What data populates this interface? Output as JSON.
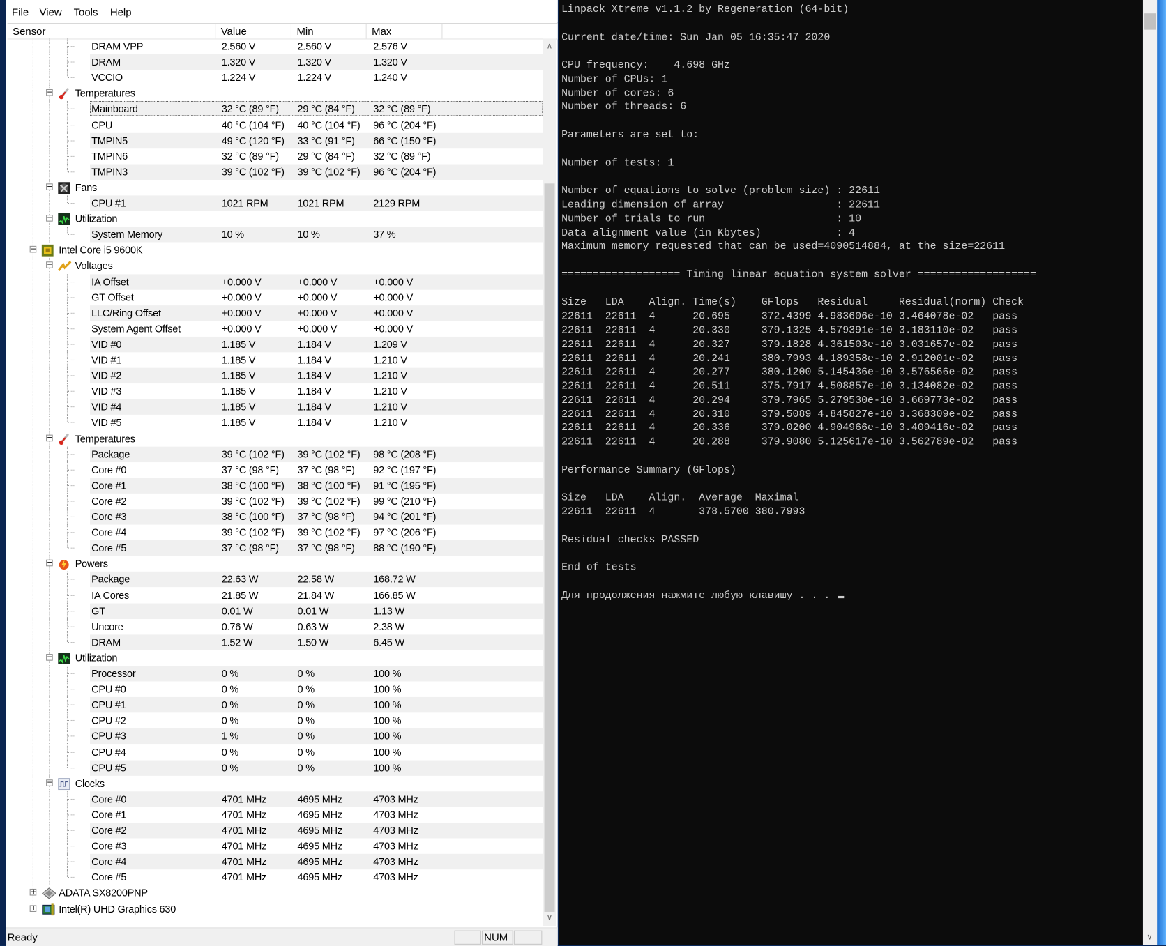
{
  "menu": [
    "File",
    "View",
    "Tools",
    "Help"
  ],
  "columns": {
    "sensor": "Sensor",
    "value": "Value",
    "min": "Min",
    "max": "Max"
  },
  "rows": [
    {
      "type": "leaf",
      "label": "DRAM VPP",
      "value": "2.560 V",
      "min": "2.560 V",
      "max": "2.576 V"
    },
    {
      "type": "leaf",
      "label": "DRAM",
      "value": "1.320 V",
      "min": "1.320 V",
      "max": "1.320 V"
    },
    {
      "type": "leaf",
      "label": "VCCIO",
      "value": "1.224 V",
      "min": "1.224 V",
      "max": "1.240 V"
    },
    {
      "type": "group",
      "level": 1,
      "icon": "thermometer-icon",
      "label": "Temperatures"
    },
    {
      "type": "leaf",
      "label": "Mainboard",
      "value": "32 °C  (89 °F)",
      "min": "29 °C  (84 °F)",
      "max": "32 °C  (89 °F)",
      "selected": true
    },
    {
      "type": "leaf",
      "label": "CPU",
      "value": "40 °C  (104 °F)",
      "min": "40 °C  (104 °F)",
      "max": "96 °C  (204 °F)"
    },
    {
      "type": "leaf",
      "label": "TMPIN5",
      "value": "49 °C  (120 °F)",
      "min": "33 °C  (91 °F)",
      "max": "66 °C  (150 °F)"
    },
    {
      "type": "leaf",
      "label": "TMPIN6",
      "value": "32 °C  (89 °F)",
      "min": "29 °C  (84 °F)",
      "max": "32 °C  (89 °F)"
    },
    {
      "type": "leaf",
      "label": "TMPIN3",
      "value": "39 °C  (102 °F)",
      "min": "39 °C  (102 °F)",
      "max": "96 °C  (204 °F)"
    },
    {
      "type": "group",
      "level": 1,
      "icon": "fan-icon",
      "label": "Fans"
    },
    {
      "type": "leaf",
      "label": "CPU #1",
      "value": "1021 RPM",
      "min": "1021 RPM",
      "max": "2129 RPM"
    },
    {
      "type": "group",
      "level": 1,
      "icon": "utilization-icon",
      "label": "Utilization"
    },
    {
      "type": "leaf",
      "label": "System Memory",
      "value": "10 %",
      "min": "10 %",
      "max": "37 %"
    },
    {
      "type": "group",
      "level": 0,
      "icon": "cpu-chip-icon",
      "label": "Intel Core i5 9600K",
      "expanded": true
    },
    {
      "type": "group",
      "level": 1,
      "icon": "voltage-icon",
      "label": "Voltages"
    },
    {
      "type": "leaf",
      "label": "IA Offset",
      "value": "+0.000 V",
      "min": "+0.000 V",
      "max": "+0.000 V"
    },
    {
      "type": "leaf",
      "label": "GT Offset",
      "value": "+0.000 V",
      "min": "+0.000 V",
      "max": "+0.000 V"
    },
    {
      "type": "leaf",
      "label": "LLC/Ring Offset",
      "value": "+0.000 V",
      "min": "+0.000 V",
      "max": "+0.000 V"
    },
    {
      "type": "leaf",
      "label": "System Agent Offset",
      "value": "+0.000 V",
      "min": "+0.000 V",
      "max": "+0.000 V"
    },
    {
      "type": "leaf",
      "label": "VID #0",
      "value": "1.185 V",
      "min": "1.184 V",
      "max": "1.209 V"
    },
    {
      "type": "leaf",
      "label": "VID #1",
      "value": "1.185 V",
      "min": "1.184 V",
      "max": "1.210 V"
    },
    {
      "type": "leaf",
      "label": "VID #2",
      "value": "1.185 V",
      "min": "1.184 V",
      "max": "1.210 V"
    },
    {
      "type": "leaf",
      "label": "VID #3",
      "value": "1.185 V",
      "min": "1.184 V",
      "max": "1.210 V"
    },
    {
      "type": "leaf",
      "label": "VID #4",
      "value": "1.185 V",
      "min": "1.184 V",
      "max": "1.210 V"
    },
    {
      "type": "leaf",
      "label": "VID #5",
      "value": "1.185 V",
      "min": "1.184 V",
      "max": "1.210 V"
    },
    {
      "type": "group",
      "level": 1,
      "icon": "thermometer-icon",
      "label": "Temperatures"
    },
    {
      "type": "leaf",
      "label": "Package",
      "value": "39 °C  (102 °F)",
      "min": "39 °C  (102 °F)",
      "max": "98 °C  (208 °F)"
    },
    {
      "type": "leaf",
      "label": "Core #0",
      "value": "37 °C  (98 °F)",
      "min": "37 °C  (98 °F)",
      "max": "92 °C  (197 °F)"
    },
    {
      "type": "leaf",
      "label": "Core #1",
      "value": "38 °C  (100 °F)",
      "min": "38 °C  (100 °F)",
      "max": "91 °C  (195 °F)"
    },
    {
      "type": "leaf",
      "label": "Core #2",
      "value": "39 °C  (102 °F)",
      "min": "39 °C  (102 °F)",
      "max": "99 °C  (210 °F)"
    },
    {
      "type": "leaf",
      "label": "Core #3",
      "value": "38 °C  (100 °F)",
      "min": "37 °C  (98 °F)",
      "max": "94 °C  (201 °F)"
    },
    {
      "type": "leaf",
      "label": "Core #4",
      "value": "39 °C  (102 °F)",
      "min": "39 °C  (102 °F)",
      "max": "97 °C  (206 °F)"
    },
    {
      "type": "leaf",
      "label": "Core #5",
      "value": "37 °C  (98 °F)",
      "min": "37 °C  (98 °F)",
      "max": "88 °C  (190 °F)"
    },
    {
      "type": "group",
      "level": 1,
      "icon": "power-icon",
      "label": "Powers"
    },
    {
      "type": "leaf",
      "label": "Package",
      "value": "22.63 W",
      "min": "22.58 W",
      "max": "168.72 W"
    },
    {
      "type": "leaf",
      "label": "IA Cores",
      "value": "21.85 W",
      "min": "21.84 W",
      "max": "166.85 W"
    },
    {
      "type": "leaf",
      "label": "GT",
      "value": "0.01 W",
      "min": "0.01 W",
      "max": "1.13 W"
    },
    {
      "type": "leaf",
      "label": "Uncore",
      "value": "0.76 W",
      "min": "0.63 W",
      "max": "2.38 W"
    },
    {
      "type": "leaf",
      "label": "DRAM",
      "value": "1.52 W",
      "min": "1.50 W",
      "max": "6.45 W"
    },
    {
      "type": "group",
      "level": 1,
      "icon": "utilization-icon",
      "label": "Utilization"
    },
    {
      "type": "leaf",
      "label": "Processor",
      "value": "0 %",
      "min": "0 %",
      "max": "100 %"
    },
    {
      "type": "leaf",
      "label": "CPU #0",
      "value": "0 %",
      "min": "0 %",
      "max": "100 %"
    },
    {
      "type": "leaf",
      "label": "CPU #1",
      "value": "0 %",
      "min": "0 %",
      "max": "100 %"
    },
    {
      "type": "leaf",
      "label": "CPU #2",
      "value": "0 %",
      "min": "0 %",
      "max": "100 %"
    },
    {
      "type": "leaf",
      "label": "CPU #3",
      "value": "1 %",
      "min": "0 %",
      "max": "100 %"
    },
    {
      "type": "leaf",
      "label": "CPU #4",
      "value": "0 %",
      "min": "0 %",
      "max": "100 %"
    },
    {
      "type": "leaf",
      "label": "CPU #5",
      "value": "0 %",
      "min": "0 %",
      "max": "100 %"
    },
    {
      "type": "group",
      "level": 1,
      "icon": "clock-icon",
      "label": "Clocks"
    },
    {
      "type": "leaf",
      "label": "Core #0",
      "value": "4701 MHz",
      "min": "4695 MHz",
      "max": "4703 MHz"
    },
    {
      "type": "leaf",
      "label": "Core #1",
      "value": "4701 MHz",
      "min": "4695 MHz",
      "max": "4703 MHz"
    },
    {
      "type": "leaf",
      "label": "Core #2",
      "value": "4701 MHz",
      "min": "4695 MHz",
      "max": "4703 MHz"
    },
    {
      "type": "leaf",
      "label": "Core #3",
      "value": "4701 MHz",
      "min": "4695 MHz",
      "max": "4703 MHz"
    },
    {
      "type": "leaf",
      "label": "Core #4",
      "value": "4701 MHz",
      "min": "4695 MHz",
      "max": "4703 MHz"
    },
    {
      "type": "leaf",
      "label": "Core #5",
      "value": "4701 MHz",
      "min": "4695 MHz",
      "max": "4703 MHz"
    },
    {
      "type": "group",
      "level": 0,
      "icon": "ssd-icon",
      "label": "ADATA SX8200PNP",
      "expanded": false
    },
    {
      "type": "group",
      "level": 0,
      "icon": "gpu-icon",
      "label": "Intel(R) UHD Graphics 630",
      "expanded": false
    }
  ],
  "status": {
    "text": "Ready",
    "num": "NUM"
  },
  "console": {
    "lines": [
      "Linpack Xtreme v1.1.2 by Regeneration (64-bit)",
      "",
      "Current date/time: Sun Jan 05 16:35:47 2020",
      "",
      "CPU frequency:    4.698 GHz",
      "Number of CPUs: 1",
      "Number of cores: 6",
      "Number of threads: 6",
      "",
      "Parameters are set to:",
      "",
      "Number of tests: 1",
      "",
      "Number of equations to solve (problem size) : 22611",
      "Leading dimension of array                  : 22611",
      "Number of trials to run                     : 10",
      "Data alignment value (in Kbytes)            : 4",
      "Maximum memory requested that can be used=4090514884, at the size=22611",
      "",
      "=================== Timing linear equation system solver ===================",
      "",
      "Size   LDA    Align. Time(s)    GFlops   Residual     Residual(norm) Check",
      "22611  22611  4      20.695     372.4399 4.983606e-10 3.464078e-02   pass",
      "22611  22611  4      20.330     379.1325 4.579391e-10 3.183110e-02   pass",
      "22611  22611  4      20.327     379.1828 4.361503e-10 3.031657e-02   pass",
      "22611  22611  4      20.241     380.7993 4.189358e-10 2.912001e-02   pass",
      "22611  22611  4      20.277     380.1200 5.145436e-10 3.576566e-02   pass",
      "22611  22611  4      20.511     375.7917 4.508857e-10 3.134082e-02   pass",
      "22611  22611  4      20.294     379.7965 5.279530e-10 3.669773e-02   pass",
      "22611  22611  4      20.310     379.5089 4.845827e-10 3.368309e-02   pass",
      "22611  22611  4      20.336     379.0200 4.904966e-10 3.409416e-02   pass",
      "22611  22611  4      20.288     379.9080 5.125617e-10 3.562789e-02   pass",
      "",
      "Performance Summary (GFlops)",
      "",
      "Size   LDA    Align.  Average  Maximal",
      "22611  22611  4       378.5700 380.7993",
      "",
      "Residual checks PASSED",
      "",
      "End of tests",
      "",
      "Для продолжения нажмите любую клавишу . . . "
    ]
  }
}
